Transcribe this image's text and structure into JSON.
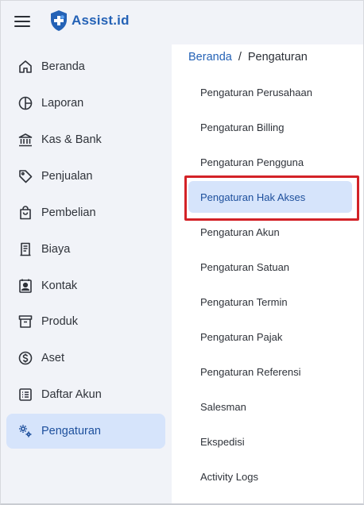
{
  "brand": {
    "name": "Assist.id",
    "color": "#2462b6"
  },
  "sidebar": {
    "items": [
      {
        "label": "Beranda",
        "icon": "home-icon"
      },
      {
        "label": "Laporan",
        "icon": "pie-chart-icon"
      },
      {
        "label": "Kas & Bank",
        "icon": "bank-icon"
      },
      {
        "label": "Penjualan",
        "icon": "tag-icon"
      },
      {
        "label": "Pembelian",
        "icon": "shopping-bag-icon"
      },
      {
        "label": "Biaya",
        "icon": "receipt-icon"
      },
      {
        "label": "Kontak",
        "icon": "contact-icon"
      },
      {
        "label": "Produk",
        "icon": "archive-icon"
      },
      {
        "label": "Aset",
        "icon": "dollar-circle-icon"
      },
      {
        "label": "Daftar Akun",
        "icon": "list-icon"
      },
      {
        "label": "Pengaturan",
        "icon": "gears-icon",
        "active": true
      }
    ]
  },
  "breadcrumb": {
    "root": "Beranda",
    "separator": "/",
    "current": "Pengaturan"
  },
  "settings_menu": {
    "items": [
      {
        "label": "Pengaturan Perusahaan"
      },
      {
        "label": "Pengaturan Billing"
      },
      {
        "label": "Pengaturan Pengguna"
      },
      {
        "label": "Pengaturan Hak Akses",
        "active": true
      },
      {
        "label": "Pengaturan Akun"
      },
      {
        "label": "Pengaturan Satuan"
      },
      {
        "label": "Pengaturan Termin"
      },
      {
        "label": "Pengaturan Pajak"
      },
      {
        "label": "Pengaturan Referensi"
      },
      {
        "label": "Salesman"
      },
      {
        "label": "Ekspedisi"
      },
      {
        "label": "Activity Logs"
      }
    ]
  },
  "colors": {
    "accent": "#2462b6",
    "active_bg": "#d6e4fb",
    "highlight": "#d32227"
  }
}
